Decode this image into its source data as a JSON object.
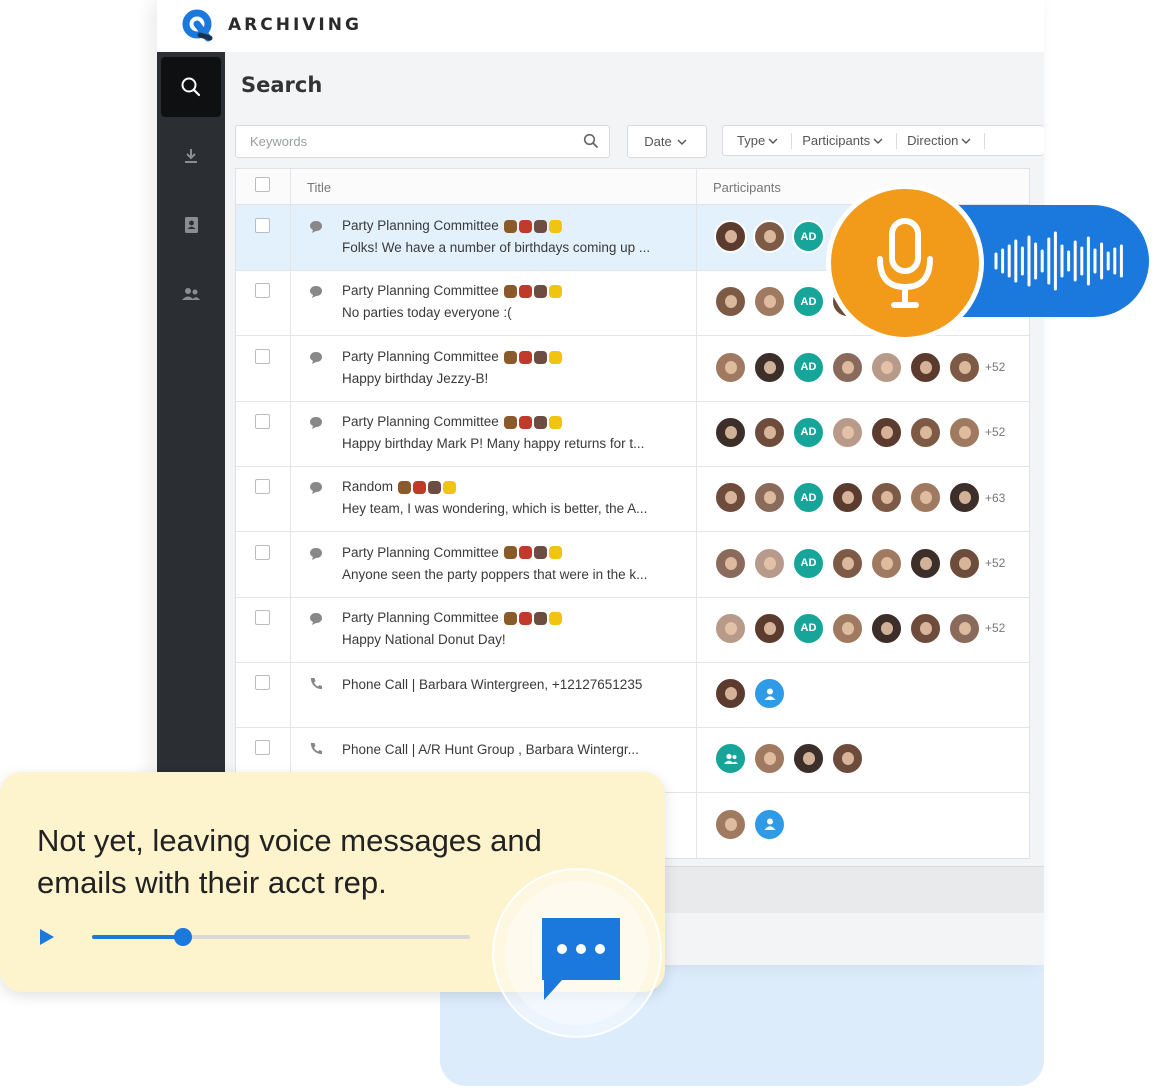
{
  "brand": {
    "name": "ARCHIVING",
    "logo_icon": "q-logo-icon",
    "accent": "#1b78dc"
  },
  "sidebar": {
    "items": [
      {
        "name": "search",
        "icon": "search-icon",
        "active": true
      },
      {
        "name": "download",
        "icon": "download-icon",
        "active": false
      },
      {
        "name": "contacts",
        "icon": "contact-book-icon",
        "active": false
      },
      {
        "name": "users",
        "icon": "users-icon",
        "active": false
      }
    ]
  },
  "page": {
    "title": "Search"
  },
  "search": {
    "placeholder": "Keywords",
    "value": ""
  },
  "filters": {
    "date": "Date",
    "type": "Type",
    "participants": "Participants",
    "direction": "Direction"
  },
  "table": {
    "headers": {
      "title": "Title",
      "participants": "Participants"
    },
    "rows": [
      {
        "kind": "chat",
        "title": "Party Planning Committee",
        "subtitle": "Folks! We have a number of birthdays coming up ...",
        "selected": true,
        "extra": ""
      },
      {
        "kind": "chat",
        "title": "Party Planning Committee",
        "subtitle": "No parties today everyone :(",
        "selected": false,
        "extra": ""
      },
      {
        "kind": "chat",
        "title": "Party Planning Committee",
        "subtitle": "Happy birthday Jezzy-B!",
        "selected": false,
        "extra": "+52"
      },
      {
        "kind": "chat",
        "title": "Party Planning Committee",
        "subtitle": "Happy birthday Mark P! Many happy returns for t...",
        "selected": false,
        "extra": "+52"
      },
      {
        "kind": "chat",
        "title": "Random",
        "subtitle": "Hey team, I was wondering, which is better, the A...",
        "selected": false,
        "extra": "+63"
      },
      {
        "kind": "chat",
        "title": "Party Planning Committee",
        "subtitle": "Anyone seen the party poppers that were in the k...",
        "selected": false,
        "extra": "+52"
      },
      {
        "kind": "chat",
        "title": "Party Planning Committee",
        "subtitle": "Happy National Donut Day!",
        "selected": false,
        "extra": "+52"
      },
      {
        "kind": "call",
        "title": "Phone Call | Barbara Wintergreen, +12127651235",
        "subtitle": "",
        "selected": false,
        "extra": ""
      },
      {
        "kind": "call",
        "title": "Phone Call | A/R Hunt Group , Barbara Wintergr...",
        "subtitle": "",
        "selected": false,
        "extra": ""
      },
      {
        "kind": "call",
        "title": "",
        "subtitle": "",
        "selected": false,
        "extra": ""
      }
    ],
    "avatar_initials": "AD"
  },
  "voice_overlay": {
    "icon": "microphone-icon",
    "wave_icon": "sound-wave-icon",
    "pill_color": "#1b78dc",
    "mic_color": "#f29a1a"
  },
  "transcript_card": {
    "text": "Not yet, leaving voice messages and emails with their acct rep.",
    "progress": 0.24,
    "play_icon": "play-icon",
    "chat_icon": "chat-bubble-icon"
  }
}
